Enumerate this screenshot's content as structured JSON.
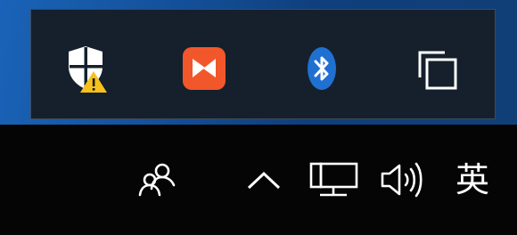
{
  "colors": {
    "taskbar_bg": "#050505",
    "flyout_bg": "#15202c",
    "flyout_border": "#3b4a5b",
    "defender_warning": "#f6c11c",
    "app_orange": "#f1572b",
    "bluetooth_blue": "#1f70d1",
    "icon_white": "#ffffff"
  },
  "overflow_tray": {
    "icons": [
      {
        "name": "windows-security-warning-icon"
      },
      {
        "name": "orange-app-icon"
      },
      {
        "name": "bluetooth-icon"
      },
      {
        "name": "task-view-icon"
      }
    ]
  },
  "taskbar": {
    "icons": [
      {
        "name": "people-icon"
      },
      {
        "name": "show-hidden-icons-chevron-icon"
      },
      {
        "name": "network-icon"
      },
      {
        "name": "volume-icon"
      }
    ],
    "ime_label": "英"
  }
}
